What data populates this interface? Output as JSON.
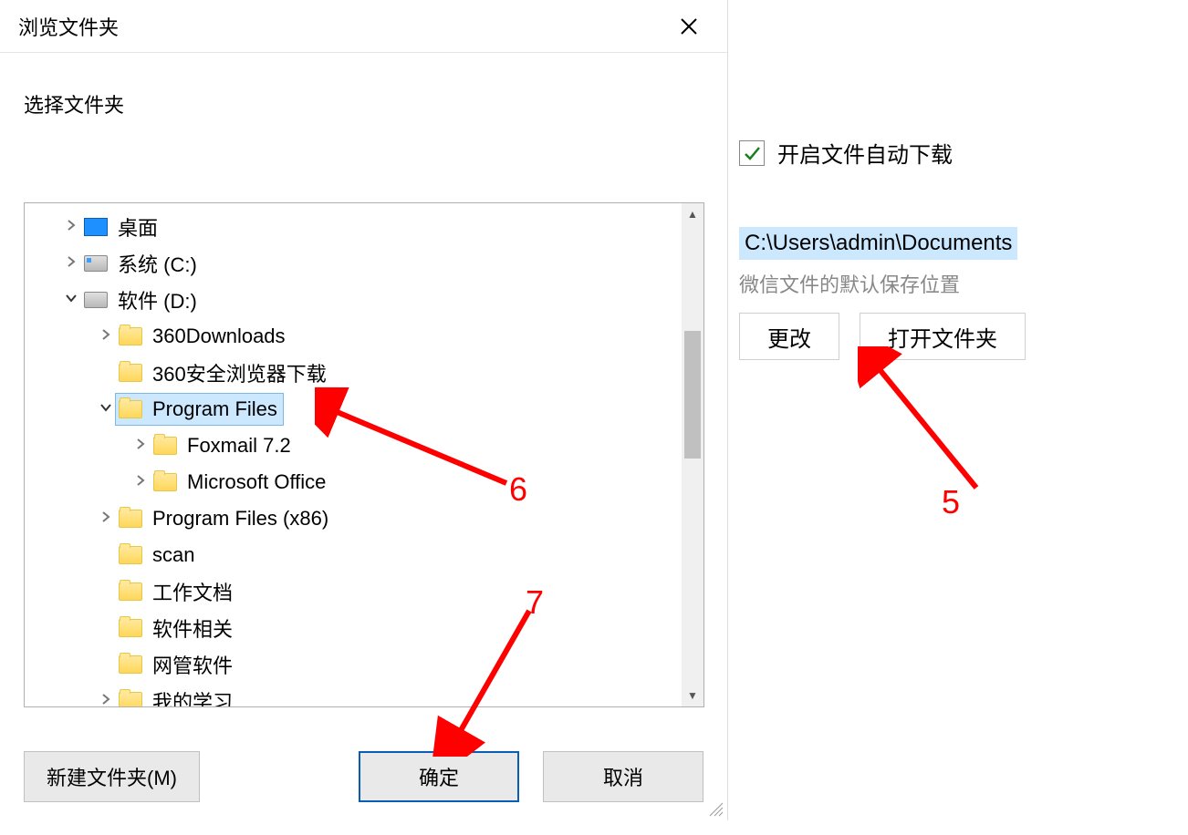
{
  "dialog": {
    "title": "浏览文件夹",
    "subtitle": "选择文件夹",
    "buttons": {
      "new_folder": "新建文件夹(M)",
      "ok": "确定",
      "cancel": "取消"
    }
  },
  "tree": [
    {
      "indent": 1,
      "expander": "right",
      "icon": "desktop",
      "label": "桌面"
    },
    {
      "indent": 1,
      "expander": "right",
      "icon": "drive-c",
      "label": "系统 (C:)"
    },
    {
      "indent": 1,
      "expander": "down",
      "icon": "drive",
      "label": "软件 (D:)"
    },
    {
      "indent": 2,
      "expander": "right",
      "icon": "folder",
      "label": "360Downloads"
    },
    {
      "indent": 2,
      "expander": "none",
      "icon": "folder",
      "label": "360安全浏览器下载"
    },
    {
      "indent": 2,
      "expander": "down",
      "icon": "folder",
      "label": "Program Files",
      "selected": true
    },
    {
      "indent": 3,
      "expander": "right",
      "icon": "folder",
      "label": "Foxmail 7.2"
    },
    {
      "indent": 3,
      "expander": "right",
      "icon": "folder",
      "label": "Microsoft Office"
    },
    {
      "indent": 2,
      "expander": "right",
      "icon": "folder",
      "label": "Program Files (x86)"
    },
    {
      "indent": 2,
      "expander": "none",
      "icon": "folder",
      "label": "scan"
    },
    {
      "indent": 2,
      "expander": "none",
      "icon": "folder",
      "label": "工作文档"
    },
    {
      "indent": 2,
      "expander": "none",
      "icon": "folder",
      "label": "软件相关"
    },
    {
      "indent": 2,
      "expander": "none",
      "icon": "folder",
      "label": "网管软件"
    },
    {
      "indent": 2,
      "expander": "right",
      "icon": "folder",
      "label": "我的学习"
    }
  ],
  "right_panel": {
    "checkbox_label": "开启文件自动下载",
    "checkbox_checked": true,
    "path": "C:\\Users\\admin\\Documents",
    "desc": "微信文件的默认保存位置",
    "buttons": {
      "change": "更改",
      "open": "打开文件夹"
    }
  },
  "annotations": {
    "n5": "5",
    "n6": "6",
    "n7": "7"
  }
}
